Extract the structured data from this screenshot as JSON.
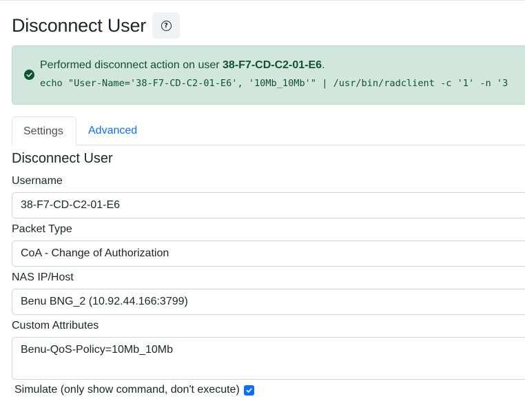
{
  "header": {
    "title": "Disconnect User",
    "help_icon": "question-circle-icon",
    "help_glyph": "?"
  },
  "alert": {
    "type": "success",
    "icon": "check-circle-icon",
    "message_prefix": "Performed disconnect action on user ",
    "message_user": "38-F7-CD-C2-01-E6",
    "message_suffix": ".",
    "command": "echo \"User-Name='38-F7-CD-C2-01-E6', '10Mb_10Mb'\" | /usr/bin/radclient  -c '1' -n '3"
  },
  "tabs": [
    {
      "label": "Settings",
      "active": true
    },
    {
      "label": "Advanced",
      "active": false
    }
  ],
  "form": {
    "section_title": "Disconnect User",
    "username": {
      "label": "Username",
      "value": "38-F7-CD-C2-01-E6"
    },
    "packet_type": {
      "label": "Packet Type",
      "value": "CoA - Change of Authorization"
    },
    "nas_host": {
      "label": "NAS IP/Host",
      "value": "Benu BNG_2 (10.92.44.166:3799)"
    },
    "custom_attributes": {
      "label": "Custom Attributes",
      "value": "Benu-QoS-Policy=10Mb_10Mb"
    },
    "simulate": {
      "label": "Simulate (only show command, don't execute)",
      "checked": true
    }
  },
  "colors": {
    "success_bg": "#d1e7dd",
    "success_text": "#0f5132",
    "link": "#0d6efd",
    "checkbox": "#0d6efd"
  }
}
